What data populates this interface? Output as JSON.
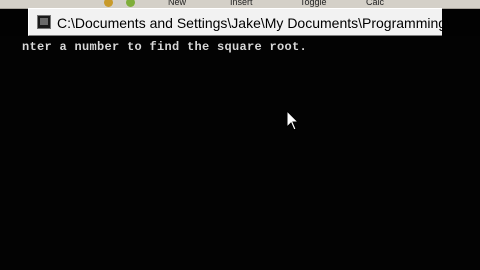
{
  "toolbar": {
    "items": [
      {
        "label": "New"
      },
      {
        "label": "Insert"
      },
      {
        "label": "Toggle"
      },
      {
        "label": "Calc"
      }
    ],
    "icons": [
      "help-icon",
      "refresh-icon"
    ]
  },
  "window": {
    "title": "C:\\Documents and Settings\\Jake\\My Documents\\Programming\\"
  },
  "console": {
    "line1": "nter a number to find the square root."
  },
  "colors": {
    "console_bg": "#030303",
    "console_text": "#d8d8d8",
    "titlebar_bg": "#f2f2f2"
  }
}
